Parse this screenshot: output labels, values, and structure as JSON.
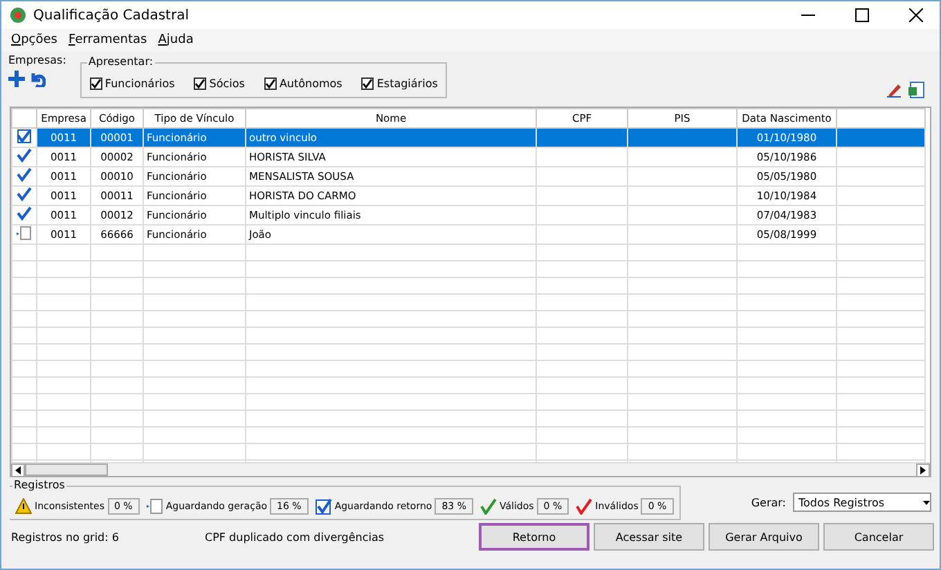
{
  "window": {
    "title": "Qualificação Cadastral"
  },
  "menu": [
    "Opções",
    "Ferramentas",
    "Ajuda"
  ],
  "empresas": {
    "label": "Empresas:"
  },
  "apresentar": {
    "title": "Apresentar:",
    "options": [
      {
        "label": "Funcionários",
        "checked": true
      },
      {
        "label": "Sócios",
        "checked": true
      },
      {
        "label": "Autônomos",
        "checked": true
      },
      {
        "label": "Estagiários",
        "checked": true
      }
    ]
  },
  "table": {
    "columns": [
      "Empresa",
      "Código",
      "Tipo de Vínculo",
      "Nome",
      "CPF",
      "PIS",
      "Data Nascimento"
    ],
    "rows": [
      {
        "kind": "retorno",
        "selected": true,
        "cells": [
          "0011",
          "00001",
          "Funcionário",
          "outro vinculo",
          "",
          "",
          "01/10/1980"
        ]
      },
      {
        "kind": "retorno",
        "selected": false,
        "cells": [
          "0011",
          "00002",
          "Funcionário",
          "HORISTA SILVA",
          "",
          "",
          "05/10/1986"
        ]
      },
      {
        "kind": "retorno",
        "selected": false,
        "cells": [
          "0011",
          "00010",
          "Funcionário",
          "MENSALISTA SOUSA",
          "",
          "",
          "05/05/1980"
        ]
      },
      {
        "kind": "retorno",
        "selected": false,
        "cells": [
          "0011",
          "00011",
          "Funcionário",
          "HORISTA DO CARMO",
          "",
          "",
          "10/10/1984"
        ]
      },
      {
        "kind": "retorno",
        "selected": false,
        "cells": [
          "0011",
          "00012",
          "Funcionário",
          "Multiplo vinculo filiais",
          "",
          "",
          "07/04/1983"
        ]
      },
      {
        "kind": "geracao",
        "selected": false,
        "cells": [
          "0011",
          "66666",
          "Funcionário",
          "João",
          "",
          "",
          "05/08/1999"
        ]
      }
    ]
  },
  "registros": {
    "title": "Registros",
    "items": [
      {
        "kind": "warning",
        "label": "Inconsistentes",
        "value": "0 %"
      },
      {
        "kind": "document",
        "label": "Aguardando geração",
        "value": "16 %"
      },
      {
        "kind": "checkbox",
        "label": "Aguardando retorno",
        "value": "83 %"
      },
      {
        "kind": "valid",
        "label": "Válidos",
        "value": "0 %"
      },
      {
        "kind": "invalid",
        "label": "Inválidos",
        "value": "0 %"
      }
    ]
  },
  "gerar": {
    "label": "Gerar:",
    "value": "Todos Registros"
  },
  "status_bar": {
    "count": "Registros no grid: 6",
    "message": "CPF duplicado com divergências"
  },
  "buttons": [
    {
      "label": "Retorno",
      "focused": true
    },
    {
      "label": "Acessar site",
      "focused": false
    },
    {
      "label": "Gerar Arquivo",
      "focused": false
    },
    {
      "label": "Cancelar",
      "focused": false
    }
  ]
}
